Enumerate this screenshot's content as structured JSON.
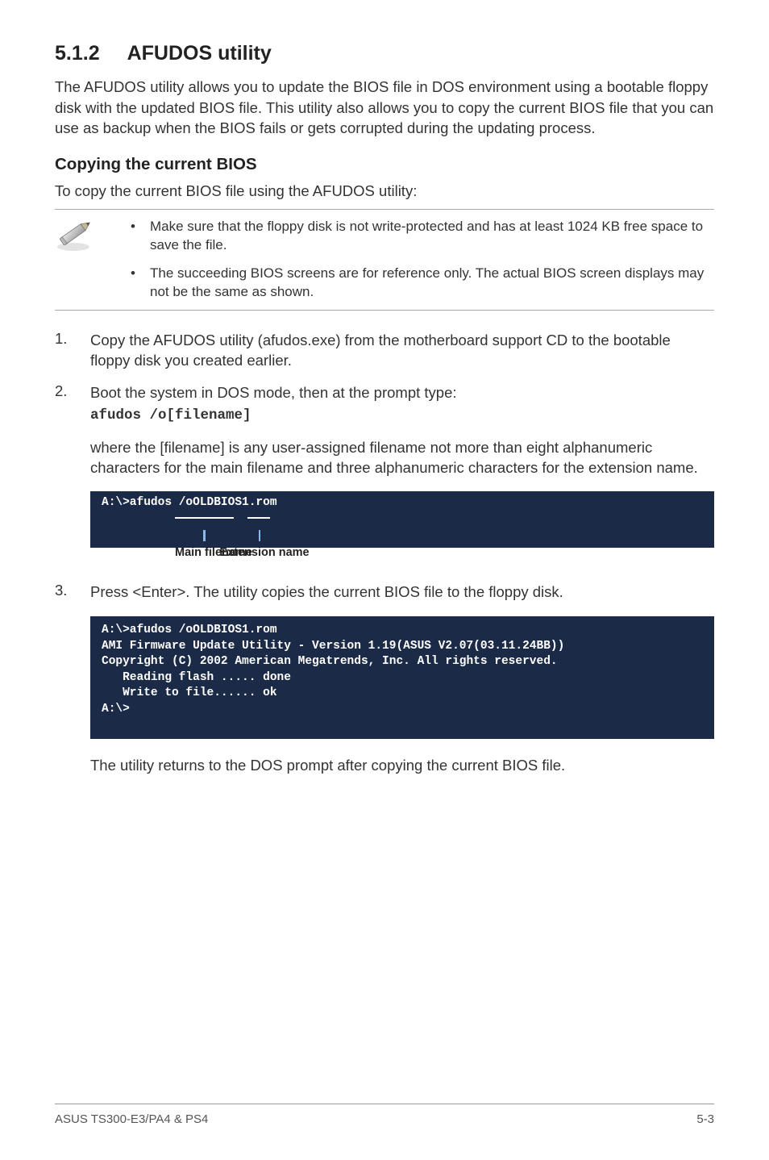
{
  "heading": {
    "number": "5.1.2",
    "title": "AFUDOS utility"
  },
  "intro": "The AFUDOS utility allows you to update the BIOS file in DOS environment using a bootable floppy disk with the updated BIOS file. This utility also allows you to copy the current BIOS file that you can use as backup when the BIOS fails or gets corrupted during the updating process.",
  "sub1": "Copying the current BIOS",
  "sub1_para": "To copy the current BIOS file using the AFUDOS utility:",
  "notes": {
    "n1": "Make sure that the floppy disk is not write-protected and has at least 1024 KB free space to save the file.",
    "n2": "The succeeding BIOS screens are for reference only. The actual BIOS screen displays may not be the same as shown."
  },
  "steps": {
    "s1": "Copy the AFUDOS utility (afudos.exe) from the motherboard support CD to the bootable floppy disk you created earlier.",
    "s2": "Boot the system in DOS mode, then at the prompt type:",
    "s2_code": "afudos /o[filename]",
    "s2_after": "where the [filename] is any user-assigned filename not more than eight alphanumeric characters  for the main filename and three alphanumeric characters for the extension name.",
    "s3": "Press <Enter>. The utility copies the current BIOS file to the floppy disk.",
    "s3_after": "The utility returns to the DOS prompt after copying the current BIOS file."
  },
  "terminal1": "A:\\>afudos /oOLDBIOS1.rom",
  "anno": {
    "main": "Main filename",
    "ext": "Extension name"
  },
  "terminal2": "A:\\>afudos /oOLDBIOS1.rom\nAMI Firmware Update Utility - Version 1.19(ASUS V2.07(03.11.24BB))\nCopyright (C) 2002 American Megatrends, Inc. All rights reserved.\n   Reading flash ..... done\n   Write to file...... ok\nA:\\>",
  "footer": {
    "left": "ASUS TS300-E3/PA4 & PS4",
    "right": "5-3"
  }
}
